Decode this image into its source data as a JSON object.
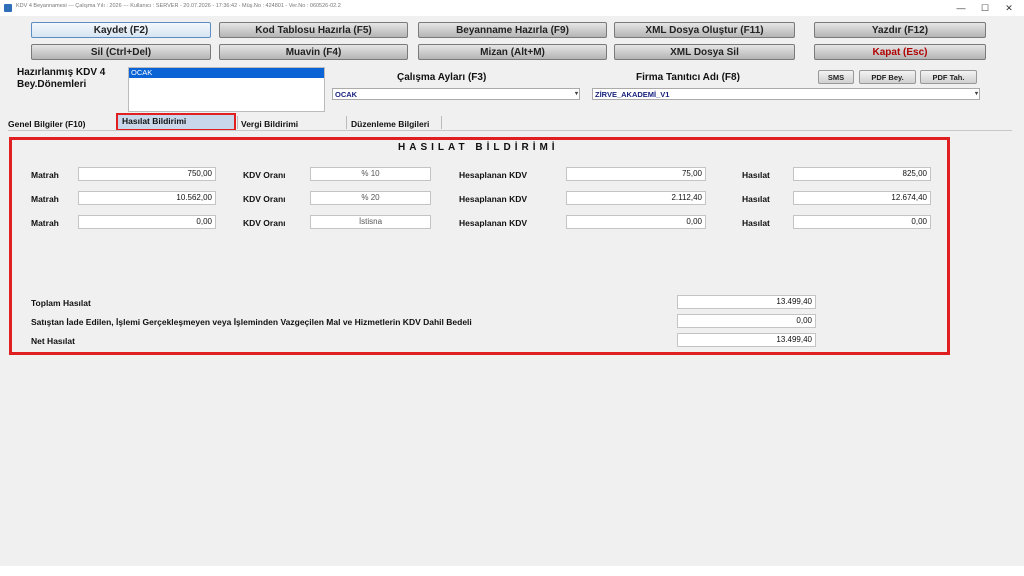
{
  "window": {
    "title": "KDV 4 Beyannamesi  ---  Çalışma Yılı : 2026  ---  Kullanıcı : SERVER - 20.07.2026 - 17:36:42 - Müş.No : 424801 - Ver.No : 060526-02.2",
    "minimize": "—",
    "maximize": "☐",
    "close": "✕",
    "icon": "app-icon"
  },
  "toolbar": {
    "row1": [
      "Kaydet (F2)",
      "Kod Tablosu Hazırla (F5)",
      "Beyanname Hazırla (F9)",
      "XML Dosya Oluştur (F11)",
      "Yazdır (F12)"
    ],
    "row2": [
      "Sil (Ctrl+Del)",
      "Muavin (F4)",
      "Mizan (Alt+M)",
      "XML Dosya Sil",
      "Kapat (Esc)"
    ]
  },
  "periods": {
    "label_line1": "Hazırlanmış KDV 4",
    "label_line2": "Bey.Dönemleri",
    "items": [
      "OCAK"
    ]
  },
  "work_months": {
    "label": "Çalışma Ayları (F3)",
    "value": "OCAK"
  },
  "firm": {
    "label": "Firma Tanıtıcı Adı (F8)",
    "value": "ZİRVE_AKADEMİ_V1"
  },
  "small_buttons": [
    "SMS",
    "PDF Bey.",
    "PDF Tah."
  ],
  "tabs": [
    "Genel Bilgiler (F10)",
    "Hasılat Bildirimi",
    "Vergi Bildirimi",
    "Düzenleme Bilgileri"
  ],
  "active_tab": "Hasılat Bildirimi",
  "hasilat": {
    "title": "HASILAT BİLDİRİMİ",
    "labels": {
      "matrah": "Matrah",
      "kdv_orani": "KDV Oranı",
      "hesaplanan_kdv": "Hesaplanan KDV",
      "hasilat": "Hasılat"
    },
    "rows": [
      {
        "matrah": "750,00",
        "kdv_orani": "% 10",
        "hesaplanan_kdv": "75,00",
        "hasilat": "825,00"
      },
      {
        "matrah": "10.562,00",
        "kdv_orani": "% 20",
        "hesaplanan_kdv": "2.112,40",
        "hasilat": "12.674,40"
      },
      {
        "matrah": "0,00",
        "kdv_orani": "İstisna",
        "hesaplanan_kdv": "0,00",
        "hasilat": "0,00"
      }
    ],
    "totals": {
      "toplam_label": "Toplam Hasılat",
      "toplam_value": "13.499,40",
      "iade_label": "Satıştan İade Edilen, İşlemi Gerçekleşmeyen veya İşleminden Vazgeçilen Mal ve Hizmetlerin KDV Dahil Bedeli",
      "iade_value": "0,00",
      "net_label": "Net Hasılat",
      "net_value": "13.499,40"
    }
  },
  "colors": {
    "highlight_border": "#e02020",
    "selection": "#0a64d6",
    "danger_text": "#b00000"
  }
}
